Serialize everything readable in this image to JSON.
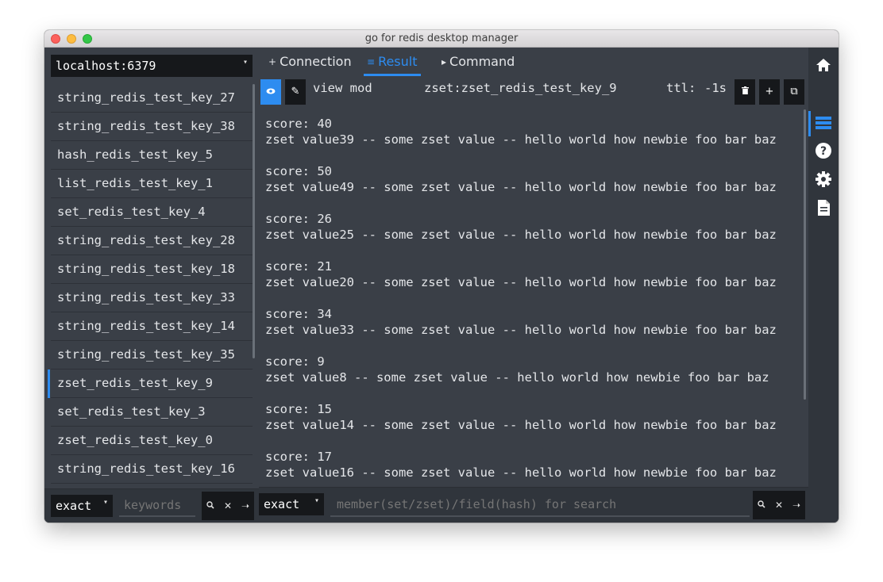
{
  "window": {
    "title": "go for redis desktop manager"
  },
  "sidebar": {
    "server": "localhost:6379",
    "keys": [
      "string_redis_test_key_27",
      "string_redis_test_key_38",
      "hash_redis_test_key_5",
      "list_redis_test_key_1",
      "set_redis_test_key_4",
      "string_redis_test_key_28",
      "string_redis_test_key_18",
      "string_redis_test_key_33",
      "string_redis_test_key_14",
      "string_redis_test_key_35",
      "zset_redis_test_key_9",
      "set_redis_test_key_3",
      "zset_redis_test_key_0",
      "string_redis_test_key_16"
    ],
    "selected_index": 10,
    "match_mode": "exact",
    "search_placeholder": "keywords"
  },
  "tabs": [
    {
      "icon": "+",
      "label": "Connection"
    },
    {
      "icon": "≡",
      "label": "Result"
    },
    {
      "icon": "▸",
      "label": "Command"
    }
  ],
  "active_tab": 1,
  "result": {
    "mode_label": "view mod",
    "key_name": "zset:zset_redis_test_key_9",
    "ttl_label": "ttl:",
    "ttl_value": "-1s",
    "items": [
      {
        "score": "score: 40",
        "value": "zset value39 -- some zset value -- hello world how newbie foo bar baz"
      },
      {
        "score": "score: 50",
        "value": "zset value49 -- some zset value -- hello world how newbie foo bar baz"
      },
      {
        "score": "score: 26",
        "value": "zset value25 -- some zset value -- hello world how newbie foo bar baz"
      },
      {
        "score": "score: 21",
        "value": "zset value20 -- some zset value -- hello world how newbie foo bar baz"
      },
      {
        "score": "score: 34",
        "value": "zset value33 -- some zset value -- hello world how newbie foo bar baz"
      },
      {
        "score": "score: 9",
        "value": "zset value8 -- some zset value -- hello world how newbie foo bar baz"
      },
      {
        "score": "score: 15",
        "value": "zset value14 -- some zset value -- hello world how newbie foo bar baz"
      },
      {
        "score": "score: 17",
        "value": "zset value16 -- some zset value -- hello world how newbie foo bar baz"
      }
    ],
    "match_mode": "exact",
    "search_placeholder": "member(set/zset)/field(hash) for search"
  },
  "colors": {
    "accent": "#2d8cf0",
    "panel": "#3a3f47",
    "dark_control": "#16181b"
  },
  "icons": {
    "sidebar": [
      "home-icon",
      "list-icon",
      "help-icon",
      "gear-icon",
      "document-icon"
    ],
    "toolbar": [
      "eye-icon",
      "pencil-icon",
      "trash-icon",
      "plus-icon",
      "copy-icon"
    ],
    "search": [
      "search-icon",
      "clear-icon",
      "arrow-right-icon"
    ]
  }
}
